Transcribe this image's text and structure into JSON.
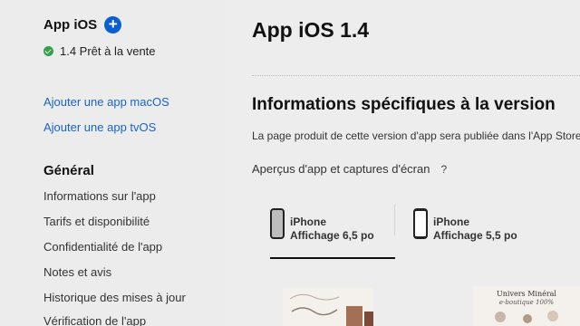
{
  "sidebar": {
    "app_name": "App iOS",
    "add_symbol": "+",
    "status": "1.4 Prêt à la vente",
    "add_macos": "Ajouter une app macOS",
    "add_tvos": "Ajouter une app tvOS",
    "general_heading": "Général",
    "nav_items": [
      "Informations sur l'app",
      "Tarifs et disponibilité",
      "Confidentialité de l'app",
      "Notes et avis",
      "Historique des mises à jour",
      "Vérification de l'app"
    ]
  },
  "main": {
    "title": "App iOS 1.4",
    "section_title": "Informations spécifiques à la version",
    "description": "La page produit de cette version d'app sera publiée dans l'App Store",
    "previews_label": "Aperçus d'app et captures d'écran",
    "help_symbol": "?",
    "tabs": [
      {
        "line1": "iPhone",
        "line2": "Affichage 6,5 po",
        "active": true
      },
      {
        "line1": "iPhone",
        "line2": "Affichage 5,5 po",
        "active": false
      }
    ],
    "screenshots": [
      {
        "brand": "Univers Minéral",
        "subtitle": "e-boutique 100%"
      }
    ]
  },
  "colors": {
    "accent": "#1a63c4",
    "add_button": "#0a5fd0",
    "status_green": "#2fa345",
    "background": "#ededed"
  }
}
